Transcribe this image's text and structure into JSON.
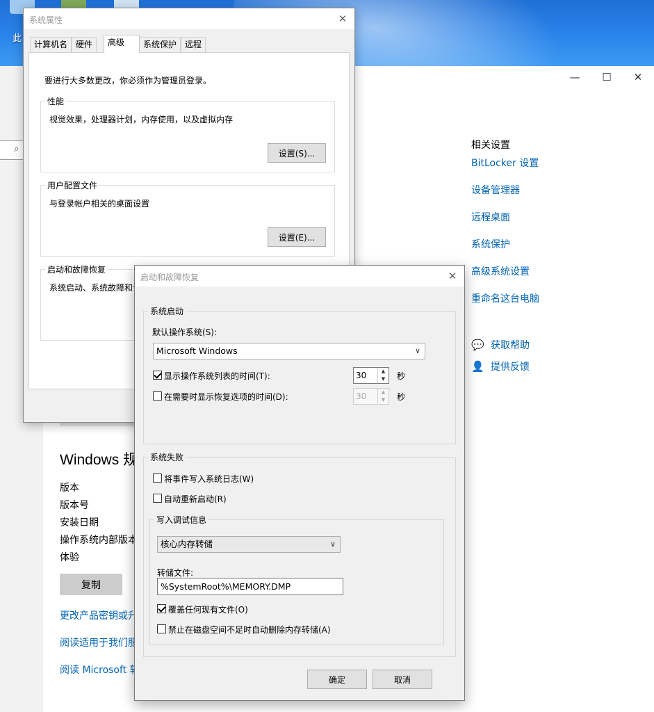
{
  "desktop": {
    "icon_label": "此"
  },
  "settings_window": {
    "controls": {
      "minimize": "—",
      "maximize": "☐",
      "close": "✕"
    },
    "related_title": "相关设置",
    "related_links": [
      "BitLocker 设置",
      "设备管理器",
      "远程桌面",
      "系统保护",
      "高级系统设置",
      "重命名这台电脑"
    ],
    "help_links": [
      "获取帮助",
      "提供反馈"
    ],
    "spec_title": "Windows 规",
    "spec_labels": [
      "版本",
      "版本号",
      "安装日期",
      "操作系统内部版本",
      "体验"
    ],
    "copy_button": "复制",
    "spec_links": [
      "更改产品密钥或升",
      "阅读适用于我们服",
      "阅读 Microsoft 软"
    ]
  },
  "system_properties": {
    "title": "系统属性",
    "close": "✕",
    "tabs": [
      "计算机名",
      "硬件",
      "高级",
      "系统保护",
      "远程"
    ],
    "active_tab": 2,
    "admin_note": "要进行大多数更改，你必须作为管理员登录。",
    "performance": {
      "legend": "性能",
      "desc": "视觉效果，处理器计划，内存使用，以及虚拟内存",
      "button": "设置(S)..."
    },
    "user_profiles": {
      "legend": "用户配置文件",
      "desc": "与登录帐户相关的桌面设置",
      "button": "设置(E)..."
    },
    "startup_recovery": {
      "legend": "启动和故障恢复",
      "desc": "系统启动、系统故障和调"
    }
  },
  "startup_dialog": {
    "title": "启动和故障恢复",
    "close": "✕",
    "system_startup": {
      "legend": "系统启动",
      "default_os_label": "默认操作系统(S):",
      "default_os_value": "Microsoft Windows",
      "show_os_list": {
        "label": "显示操作系统列表的时间(T):",
        "checked": true,
        "value": "30",
        "unit": "秒"
      },
      "show_recovery": {
        "label": "在需要时显示恢复选项的时间(D):",
        "checked": false,
        "value": "30",
        "unit": "秒"
      }
    },
    "system_failure": {
      "legend": "系统失败",
      "write_event": {
        "label": "将事件写入系统日志(W)",
        "checked": false
      },
      "auto_restart": {
        "label": "自动重新启动(R)",
        "checked": false
      },
      "debug_info": {
        "legend": "写入调试信息",
        "dump_type": "核心内存转储",
        "dump_file_label": "转储文件:",
        "dump_file_value": "%SystemRoot%\\MEMORY.DMP",
        "overwrite": {
          "label": "覆盖任何现有文件(O)",
          "checked": true
        },
        "disable_auto_delete": {
          "label": "禁止在磁盘空间不足时自动删除内存转储(A)",
          "checked": false
        }
      }
    },
    "ok_button": "确定",
    "cancel_button": "取消"
  }
}
